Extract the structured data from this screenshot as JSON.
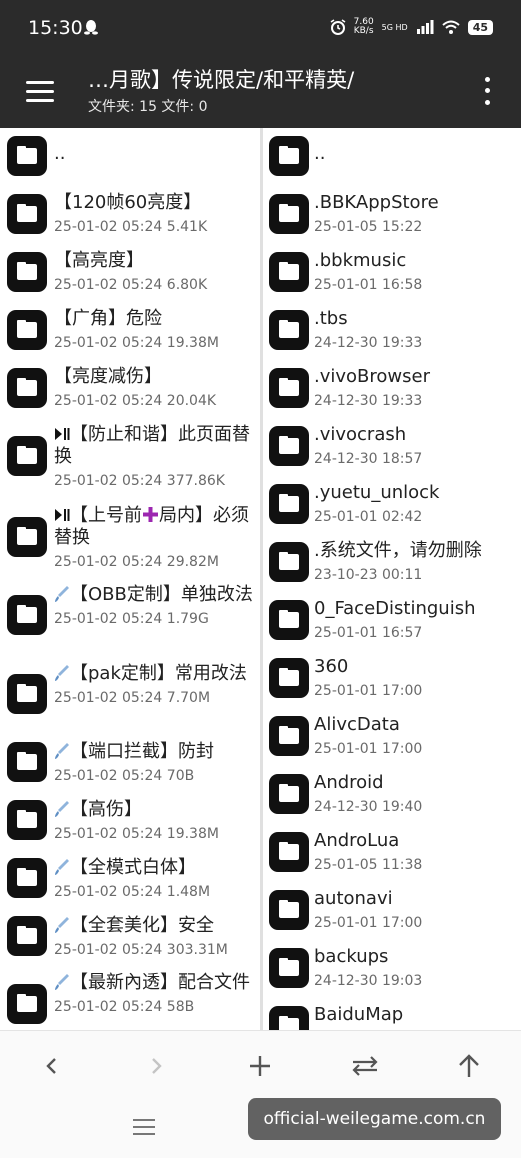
{
  "status_bar": {
    "time": "15:30",
    "net_speed_value": "7.60",
    "net_speed_unit": "KB/s",
    "network_type": "5G HD",
    "battery": "45"
  },
  "app_bar": {
    "title": "…月歌】传说限定/和平精英/",
    "subtitle": "文件夹: 15  文件: 0"
  },
  "left_pane": {
    "items": [
      {
        "name": "..",
        "meta": "",
        "prefix": ""
      },
      {
        "name": "【120帧60亮度】",
        "meta": "25-01-02 05:24  5.41K",
        "prefix": ""
      },
      {
        "name": "【高亮度】",
        "meta": "25-01-02 05:24  6.80K",
        "prefix": ""
      },
      {
        "name": "【广角】危险",
        "meta": "25-01-02 05:24  19.38M",
        "prefix": ""
      },
      {
        "name": "【亮度减伤】",
        "meta": "25-01-02 05:24  20.04K",
        "prefix": ""
      },
      {
        "name": "【防止和谐】此页面替换",
        "meta": "25-01-02 05:24  377.86K",
        "prefix": "play-pause-icon"
      },
      {
        "name_a": "【上号前",
        "name_b": "局内】必须替换",
        "meta": "25-01-02 05:24  29.82M",
        "prefix": "play-pause-icon",
        "mid_icon": "plus-icon"
      },
      {
        "name": "【OBB定制】单独改法",
        "meta": "25-01-02 05:24  1.79G",
        "prefix": "brush-icon"
      },
      {
        "name": "【pak定制】常用改法",
        "meta": "25-01-02 05:24  7.70M",
        "prefix": "brush-icon"
      },
      {
        "name": "【端口拦截】防封",
        "meta": "25-01-02 05:24  70B",
        "prefix": "brush-icon"
      },
      {
        "name": "【高伤】",
        "meta": "25-01-02 05:24  19.38M",
        "prefix": "brush-icon"
      },
      {
        "name": "【全模式白体】",
        "meta": "25-01-02 05:24  1.48M",
        "prefix": "brush-icon"
      },
      {
        "name": "【全套美化】安全",
        "meta": "25-01-02 05:24  303.31M",
        "prefix": "brush-icon"
      },
      {
        "name": "【最新內透】配合文件",
        "meta": "25-01-02 05:24  58B",
        "prefix": "brush-icon"
      }
    ]
  },
  "right_pane": {
    "items": [
      {
        "name": "..",
        "meta": ""
      },
      {
        "name": ".BBKAppStore",
        "meta": "25-01-05 15:22"
      },
      {
        "name": ".bbkmusic",
        "meta": "25-01-01 16:58"
      },
      {
        "name": ".tbs",
        "meta": "24-12-30 19:33"
      },
      {
        "name": ".vivoBrowser",
        "meta": "24-12-30 19:33"
      },
      {
        "name": ".vivocrash",
        "meta": "24-12-30 18:57"
      },
      {
        "name": ".yuetu_unlock",
        "meta": "25-01-01 02:42"
      },
      {
        "name": ".系统文件，请勿删除",
        "meta": "23-10-23 00:11"
      },
      {
        "name": "0_FaceDistinguish",
        "meta": "25-01-01 16:57"
      },
      {
        "name": "360",
        "meta": "25-01-01 17:00"
      },
      {
        "name": "AlivcData",
        "meta": "25-01-01 17:00"
      },
      {
        "name": "Android",
        "meta": "24-12-30 19:40"
      },
      {
        "name": "AndroLua",
        "meta": "25-01-05 11:38"
      },
      {
        "name": "autonavi",
        "meta": "25-01-01 17:00"
      },
      {
        "name": "backups",
        "meta": "24-12-30 19:03"
      },
      {
        "name": "BaiduMap",
        "meta": ""
      }
    ]
  },
  "toolbar": {
    "buttons": [
      "back-icon",
      "forward-icon",
      "add-icon",
      "swap-icon",
      "up-arrow-icon"
    ]
  },
  "watermark": "official-weilegame.com.cn",
  "colors": {
    "bar_background": "#2b2b2b",
    "folder_icon": "#111111",
    "meta_text": "#6a6a6a",
    "brush_icon": "#8fb4dc",
    "plus_icon": "#9c27b0"
  }
}
